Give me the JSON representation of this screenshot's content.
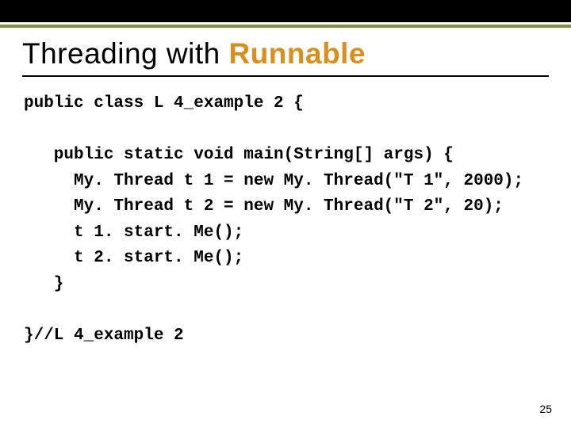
{
  "title": {
    "prefix": "Threading with ",
    "accent": "Runnable"
  },
  "code": {
    "line1": "public class L 4_example 2 {",
    "line3": "   public static void main(String[] args) {",
    "line4": "     My. Thread t 1 = new My. Thread(\"T 1\", 2000);",
    "line5": "     My. Thread t 2 = new My. Thread(\"T 2\", 20);",
    "line6": "     t 1. start. Me();",
    "line7": "     t 2. start. Me();",
    "line8": "   }",
    "line10": "}//L 4_example 2"
  },
  "page_number": "25"
}
